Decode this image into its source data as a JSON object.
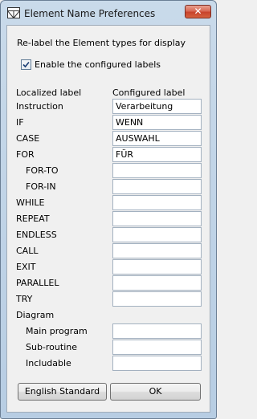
{
  "window": {
    "title": "Element Name Preferences",
    "close_glyph": "✕"
  },
  "description": "Re-label the Element types for display",
  "enable_checkbox": {
    "label": "Enable the configured labels",
    "checked": true
  },
  "columns": {
    "localized": "Localized label",
    "configured": "Configured label"
  },
  "rows": [
    {
      "label": "Instruction",
      "value": "Verarbeitung"
    },
    {
      "label": "IF",
      "value": "WENN"
    },
    {
      "label": "CASE",
      "value": "AUSWAHL"
    },
    {
      "label": "FOR",
      "value": "FÜR"
    },
    {
      "label": "FOR-TO",
      "value": ""
    },
    {
      "label": "FOR-IN",
      "value": ""
    },
    {
      "label": "WHILE",
      "value": ""
    },
    {
      "label": "REPEAT",
      "value": ""
    },
    {
      "label": "ENDLESS",
      "value": ""
    },
    {
      "label": "CALL",
      "value": ""
    },
    {
      "label": "EXIT",
      "value": ""
    },
    {
      "label": "PARALLEL",
      "value": ""
    },
    {
      "label": "TRY",
      "value": ""
    },
    {
      "label": "Diagram",
      "value": null
    },
    {
      "label": "Main program",
      "value": ""
    },
    {
      "label": "Sub-routine",
      "value": ""
    },
    {
      "label": "Includable",
      "value": ""
    }
  ],
  "buttons": {
    "english_standard": "English Standard",
    "ok": "OK"
  }
}
